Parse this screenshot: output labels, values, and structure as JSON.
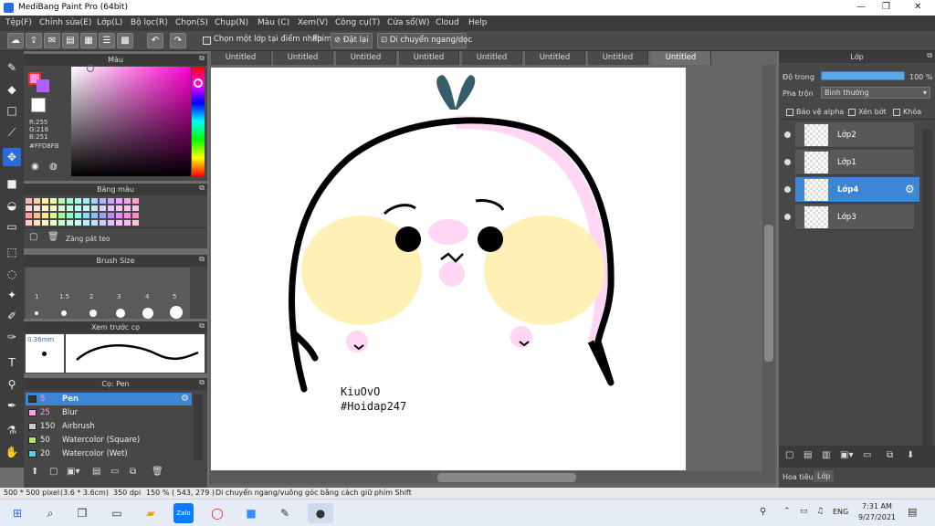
{
  "window": {
    "title": "MediBang Paint Pro (64bit)"
  },
  "menu": [
    "Tệp(F)",
    "Chỉnh sửa(E)",
    "Lớp(L)",
    "Bộ lọc(R)",
    "Chọn(S)",
    "Chụp(N)",
    "Màu (C)",
    "Xem(V)",
    "Công cụ(T)",
    "Cửa sổ(W)",
    "Cloud",
    "Help"
  ],
  "toolbar": {
    "select_layer_checkbox": "Chọn một lớp tại điểm nhấp",
    "key_label": "Phím",
    "reset_label": "Đặt lại",
    "move_label": "Di chuyển ngang/dọc"
  },
  "color_panel": {
    "title": "Màu",
    "r": "R:255",
    "g": "G:216",
    "b": "B:251",
    "hex": "#FFD8FB"
  },
  "palette_panel": {
    "title": "Bảng màu",
    "palette_name": "Zàng pát teo"
  },
  "brushsize_panel": {
    "title": "Brush Size",
    "sizes": [
      "1",
      "1.5",
      "2",
      "3",
      "4",
      "5"
    ]
  },
  "preview_panel": {
    "title": "Xem trước cọ",
    "size": "0.36mm"
  },
  "brush_panel": {
    "title": "Cọ: Pen",
    "brushes": [
      {
        "size": "5",
        "name": "Pen",
        "color": "#333333"
      },
      {
        "size": "25",
        "name": "Blur",
        "color": "#ff9ef0"
      },
      {
        "size": "150",
        "name": "Airbrush",
        "color": "#cccccc"
      },
      {
        "size": "50",
        "name": "Watercolor (Square)",
        "color": "#b6e36a"
      },
      {
        "size": "20",
        "name": "Watercolor (Wet)",
        "color": "#57d1f2"
      }
    ]
  },
  "tabs": [
    "Untitled",
    "Untitled",
    "Untitled",
    "Untitled",
    "Untitled",
    "Untitled",
    "Untitled",
    "Untitled"
  ],
  "canvas_text": {
    "line1": "KiuOvO",
    "line2": "#Hoidap247"
  },
  "layer_panel": {
    "title": "Lớp",
    "opacity_label": "Độ trong",
    "opacity_value": "100 %",
    "blend_label": "Pha trộn",
    "blend_value": "Bình thường",
    "protect_alpha": "Bảo vệ alpha",
    "clip": "Xén bớt",
    "lock": "Khóa",
    "layers": [
      "Lớp2",
      "Lớp1",
      "Lớp4",
      "Lớp3"
    ]
  },
  "bottom_tabs": {
    "material": "Hoa tiêu",
    "layer": "Lớp"
  },
  "status": {
    "size": "500 * 500 pixel",
    "cm": "(3.6 * 3.6cm)",
    "dpi": "350 dpi",
    "zoom": "150 %",
    "coords": "( 543, 279 )",
    "hint": "Di chuyển ngang/vuông góc bằng cách giữ phím Shift"
  },
  "taskbar": {
    "lang": "ENG",
    "time": "7:31 AM",
    "date": "9/27/2021"
  }
}
